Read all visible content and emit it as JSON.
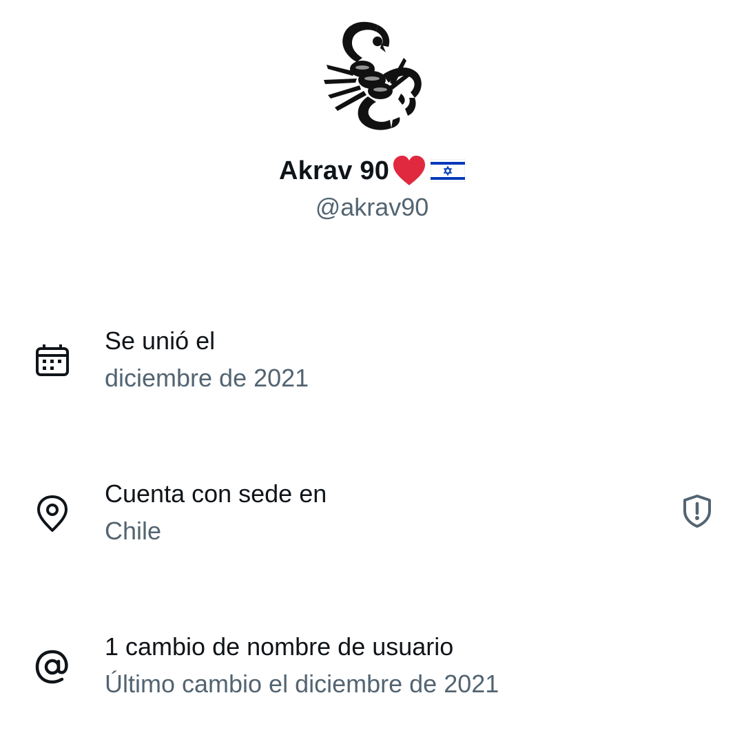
{
  "profile": {
    "display_name": "Akrav 90",
    "handle": "@akrav90",
    "name_emojis": [
      "red-heart",
      "israel-flag"
    ]
  },
  "about": {
    "joined": {
      "label": "Se unió el",
      "value": "diciembre de 2021",
      "icon": "calendar-icon"
    },
    "location": {
      "label": "Cuenta con sede en",
      "value": "Chile",
      "icon": "location-pin-icon",
      "action_icon": "shield-alert-icon"
    },
    "username_changes": {
      "label": "1 cambio de nombre de usuario",
      "value": "Último cambio el diciembre de 2021",
      "icon": "at-sign-icon"
    }
  },
  "colors": {
    "primary_text": "#0f1419",
    "secondary_text": "#536471",
    "heart": "#e0293f",
    "flag_blue": "#0038b8"
  }
}
